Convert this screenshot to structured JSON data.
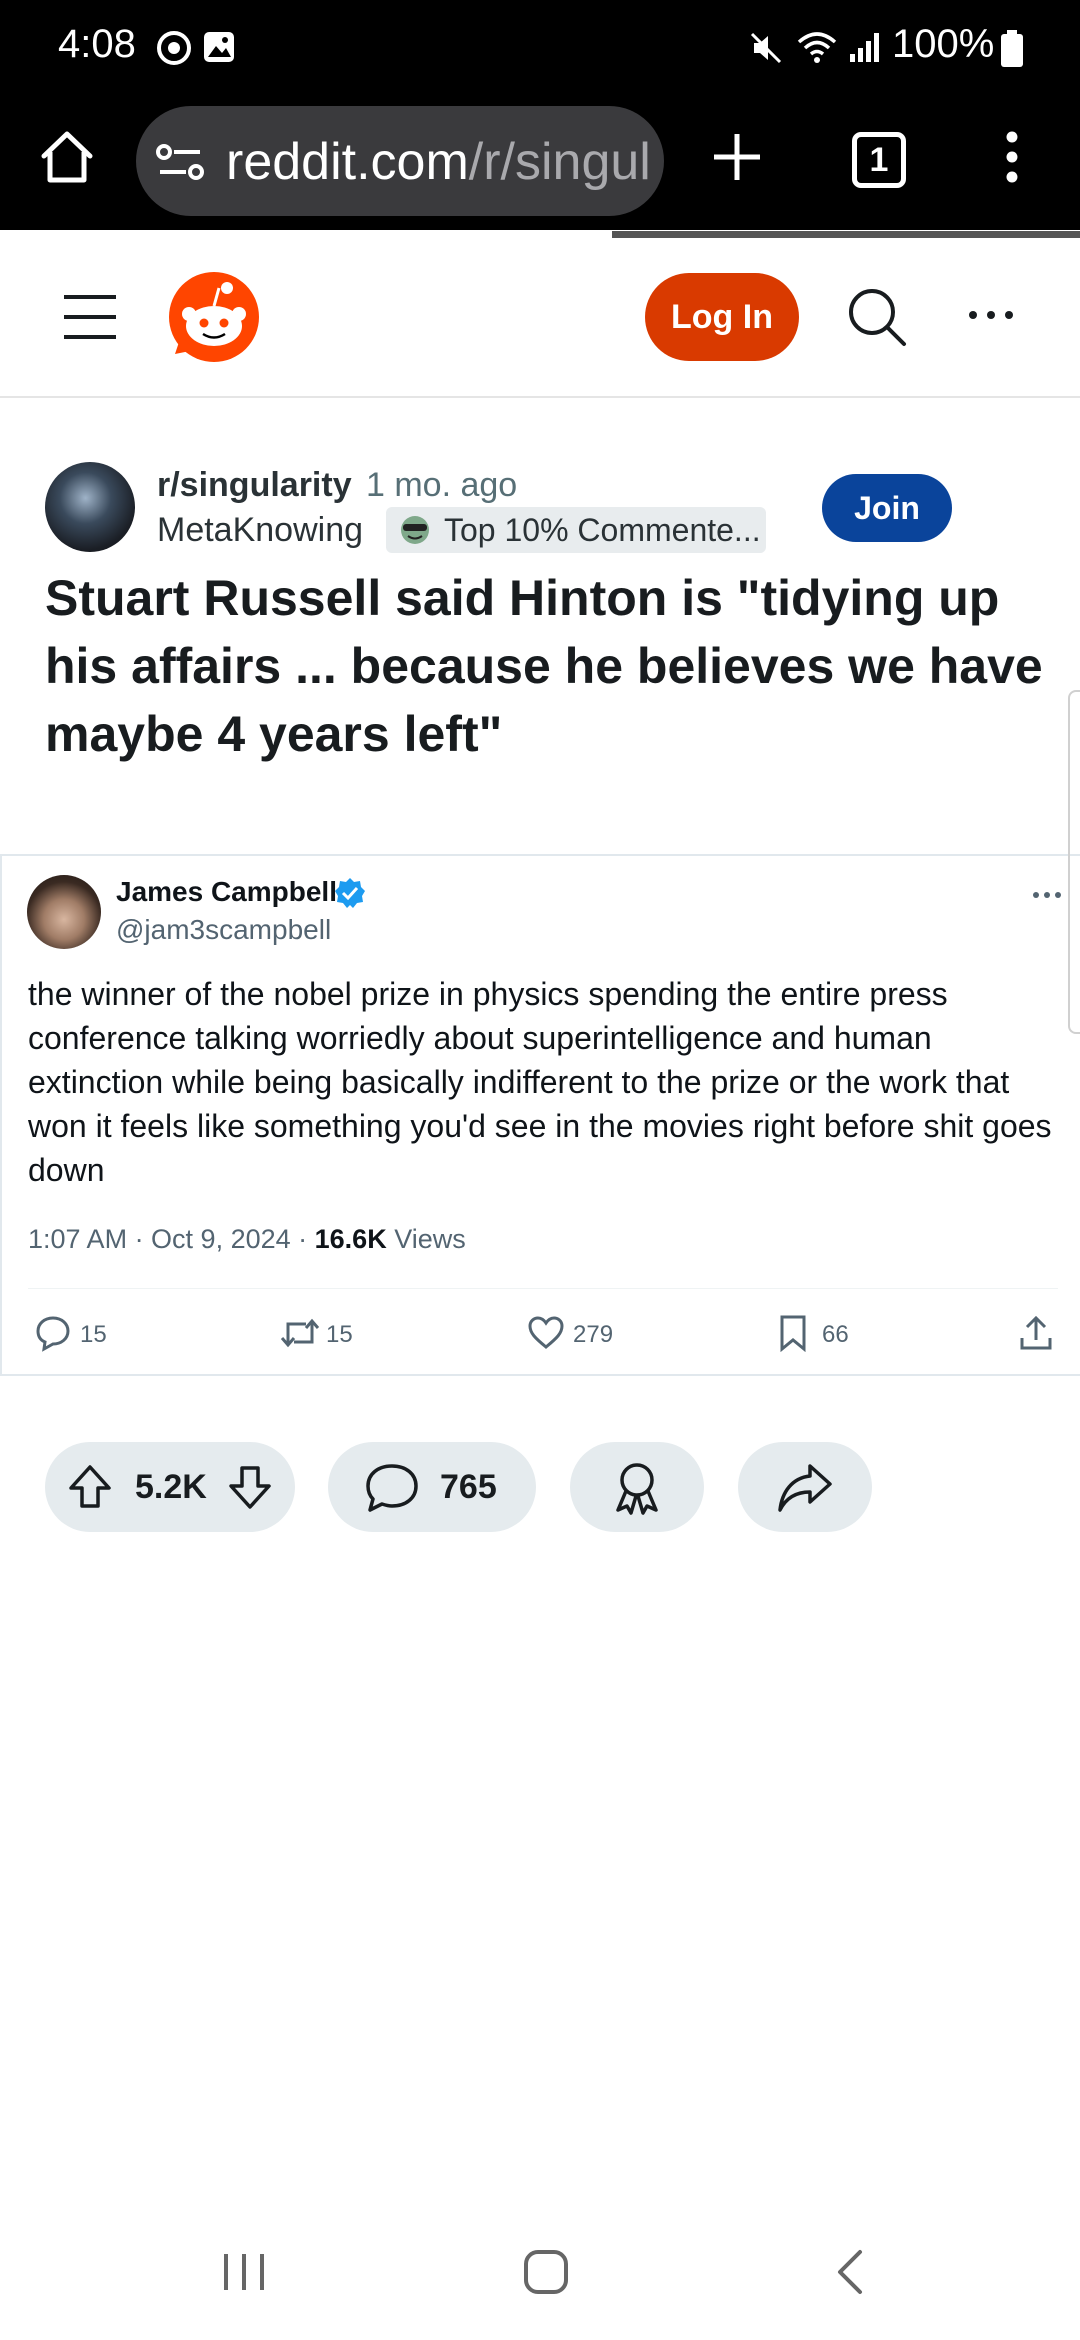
{
  "status_bar": {
    "time": "4:08",
    "battery": "100%"
  },
  "browser": {
    "url_domain": "reddit.com",
    "url_path": "/r/singul",
    "tab_count": "1"
  },
  "reddit_header": {
    "login_label": "Log In"
  },
  "post": {
    "subreddit": "r/singularity",
    "time_ago": "1 mo. ago",
    "author": "MetaKnowing",
    "flair": "Top 10% Commente...",
    "join_label": "Join",
    "title": "Stuart Russell said Hinton is \"tidying up his affairs ... because he believes we have maybe 4 years left\""
  },
  "tweet": {
    "name": "James Campbell",
    "handle": "@jam3scampbell",
    "text": "the winner of the nobel prize in physics spending the entire press conference talking worriedly about superintelligence and human extinction while being basically indifferent to the prize or the work that won it feels like something you'd see in the movies right before shit goes down",
    "timestamp": "1:07 AM · Oct 9, 2024 · ",
    "views_count": "16.6K",
    "views_label": " Views",
    "replies": "15",
    "retweets": "15",
    "likes": "279",
    "bookmarks": "66"
  },
  "actions": {
    "votes": "5.2K",
    "comments": "765"
  },
  "colors": {
    "login": "#d93a00",
    "join": "#0a449b",
    "reddit_logo": "#ff4500",
    "pill_bg": "#e5ebee",
    "verified": "#1d9bf0"
  }
}
